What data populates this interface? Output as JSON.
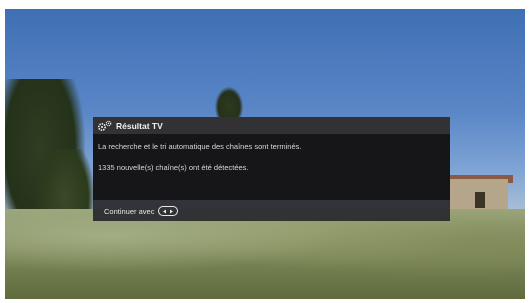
{
  "dialog": {
    "title": "Résultat TV",
    "icon": "settings-gears-icon",
    "message_line1": "La recherche et le tri automatique des chaînes sont terminés.",
    "message_line2": "1335 nouvelle(s) chaîne(s) ont été détectées.",
    "continue_label": "Continuer avec",
    "continue_icon": "ok-button-icon"
  },
  "colors": {
    "header_bg": "#323235",
    "body_bg": "#161619",
    "footer_bg": "#28282c",
    "text": "#d8d8d8"
  }
}
